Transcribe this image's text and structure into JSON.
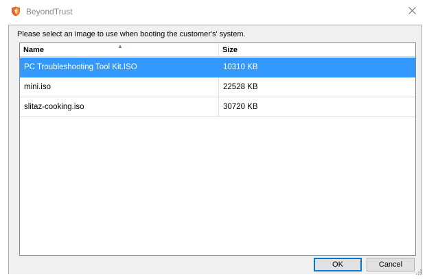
{
  "window": {
    "title": "BeyondTrust",
    "close_glyph": "✕"
  },
  "dialog": {
    "prompt": "Please select an image to use when booting the customer's' system.",
    "columns": {
      "name": "Name",
      "size": "Size",
      "sorted_by": "Name",
      "sort_direction": "ascending"
    },
    "rows": [
      {
        "name": "PC Troubleshooting Tool Kit.ISO",
        "size": "10310 KB",
        "selected": true
      },
      {
        "name": "mini.iso",
        "size": "22528 KB",
        "selected": false
      },
      {
        "name": "slitaz-cooking.iso",
        "size": "30720 KB",
        "selected": false
      }
    ],
    "buttons": {
      "ok": "OK",
      "cancel": "Cancel"
    }
  },
  "colors": {
    "selection": "#3399ff",
    "brand_icon": "#e8632a",
    "default_button_border": "#0078d7"
  },
  "icons": {
    "app": "beyondtrust-shield-icon",
    "close": "close-icon",
    "sort": "sort-ascending-icon",
    "resize": "resize-grip-icon"
  }
}
